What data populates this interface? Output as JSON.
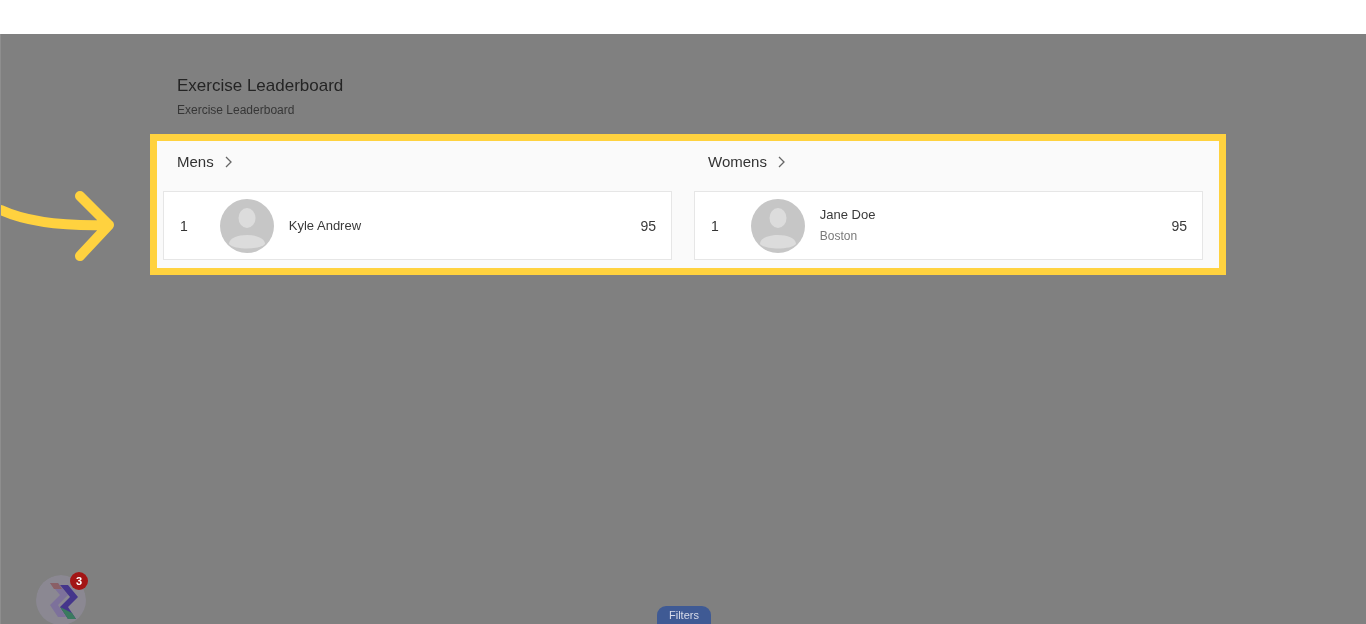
{
  "page": {
    "title": "Exercise Leaderboard",
    "subtitle": "Exercise Leaderboard"
  },
  "leaderboards": [
    {
      "title": "Mens",
      "entries": [
        {
          "rank": "1",
          "name": "Kyle Andrew",
          "score": "95"
        }
      ]
    },
    {
      "title": "Womens",
      "entries": [
        {
          "rank": "1",
          "name": "Jane Doe",
          "location": "Boston",
          "score": "95"
        }
      ]
    }
  ],
  "launcher": {
    "badge": "3"
  },
  "filters_button": {
    "label": "Filters"
  }
}
